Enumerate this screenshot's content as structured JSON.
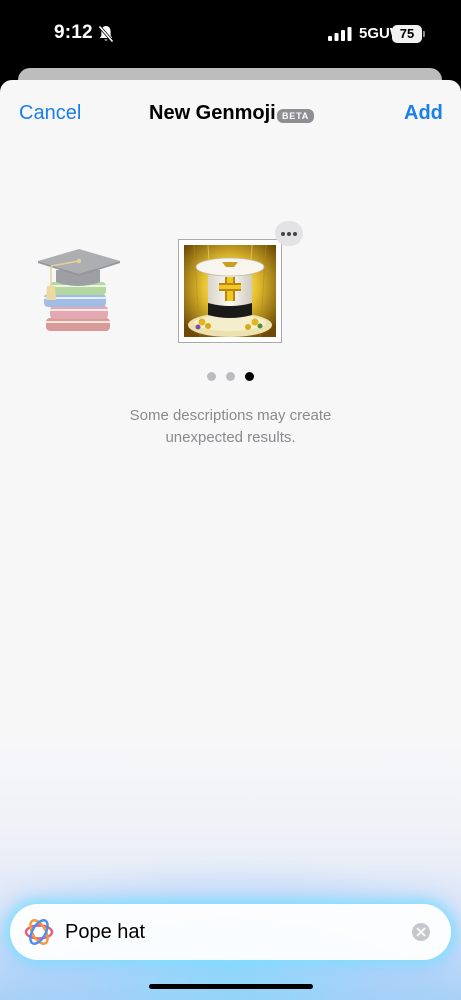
{
  "status_bar": {
    "time": "9:12",
    "network": "5GUW",
    "battery": "75",
    "icons": [
      "bell-slash-icon",
      "cellular-signal-icon",
      "battery-icon"
    ]
  },
  "nav": {
    "cancel_label": "Cancel",
    "title": "New Genmoji",
    "badge": "BETA",
    "add_label": "Add"
  },
  "carousel": {
    "items": [
      {
        "icon": "graduation-cap-books-emoji",
        "selected": false
      },
      {
        "icon": "pope-hat-genmoji",
        "selected": true
      }
    ],
    "more_icon": "ellipsis-icon",
    "page_count": 3,
    "current_page": 3
  },
  "hint": {
    "line1": "Some descriptions may create",
    "line2": "unexpected results."
  },
  "input": {
    "value": "Pope hat",
    "icon": "apple-intelligence-icon",
    "clear_icon": "clear-icon"
  },
  "colors": {
    "accent": "#1a7fe6",
    "badge": "#8e8e93",
    "hint": "#8a8a8e",
    "glow": "#78e1ff"
  }
}
